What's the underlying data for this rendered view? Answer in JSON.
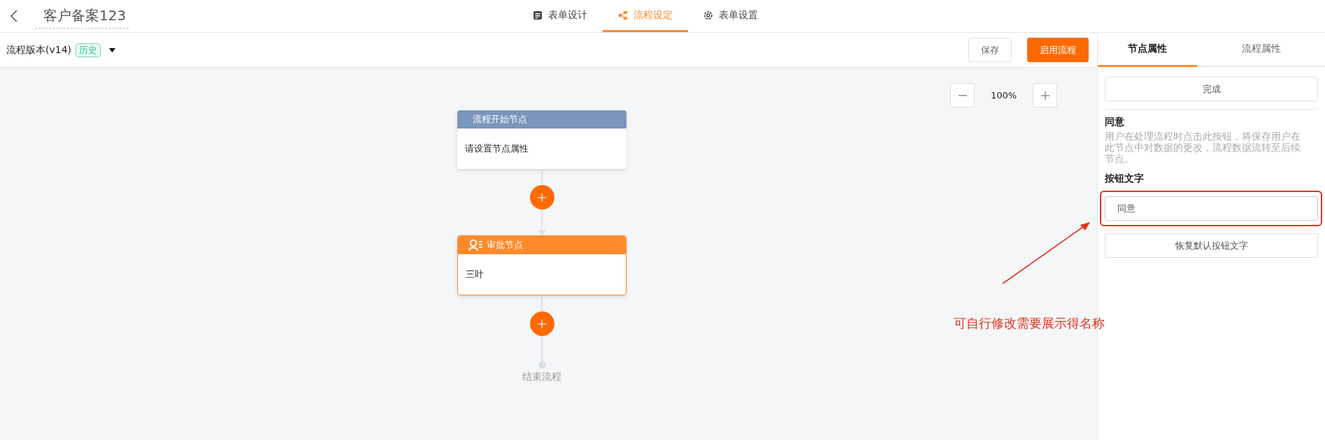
{
  "header": {
    "title": "客户备案123",
    "tabs": [
      {
        "label": "表单设计",
        "kind": "form",
        "selected": false
      },
      {
        "label": "流程设定",
        "kind": "flow",
        "selected": true
      },
      {
        "label": "表单设置",
        "kind": "gear",
        "selected": false
      }
    ]
  },
  "toolbar": {
    "version": "流程版本(v14)",
    "badge": "历史",
    "buttons": [
      {
        "label": "保存",
        "kind": "secondary"
      },
      {
        "label": "启用流程",
        "kind": "primary"
      }
    ]
  },
  "canvas": {
    "zoom": "100%",
    "nodes": [
      {
        "kind": "start",
        "title": "流程开始节点",
        "body": "请设置节点属性"
      },
      {
        "kind": "approval",
        "title": "审批节点",
        "body": "三叶"
      }
    ],
    "end_label": "结束流程"
  },
  "panel": {
    "tabs": [
      {
        "label": "节点属性",
        "selected": true
      },
      {
        "label": "流程属性",
        "selected": false
      }
    ],
    "done_button": "完成",
    "heading": "同意",
    "description": "用户在处理流程时点击此按钮，将保存用户在此节点中对数据的更改，流程数据流转至后续节点。",
    "field_label": "按钮文字",
    "field_value": "同意",
    "reset_button": "恢复默认按钮文字"
  },
  "annotation": {
    "text": "可自行修改需要展示得名称"
  }
}
